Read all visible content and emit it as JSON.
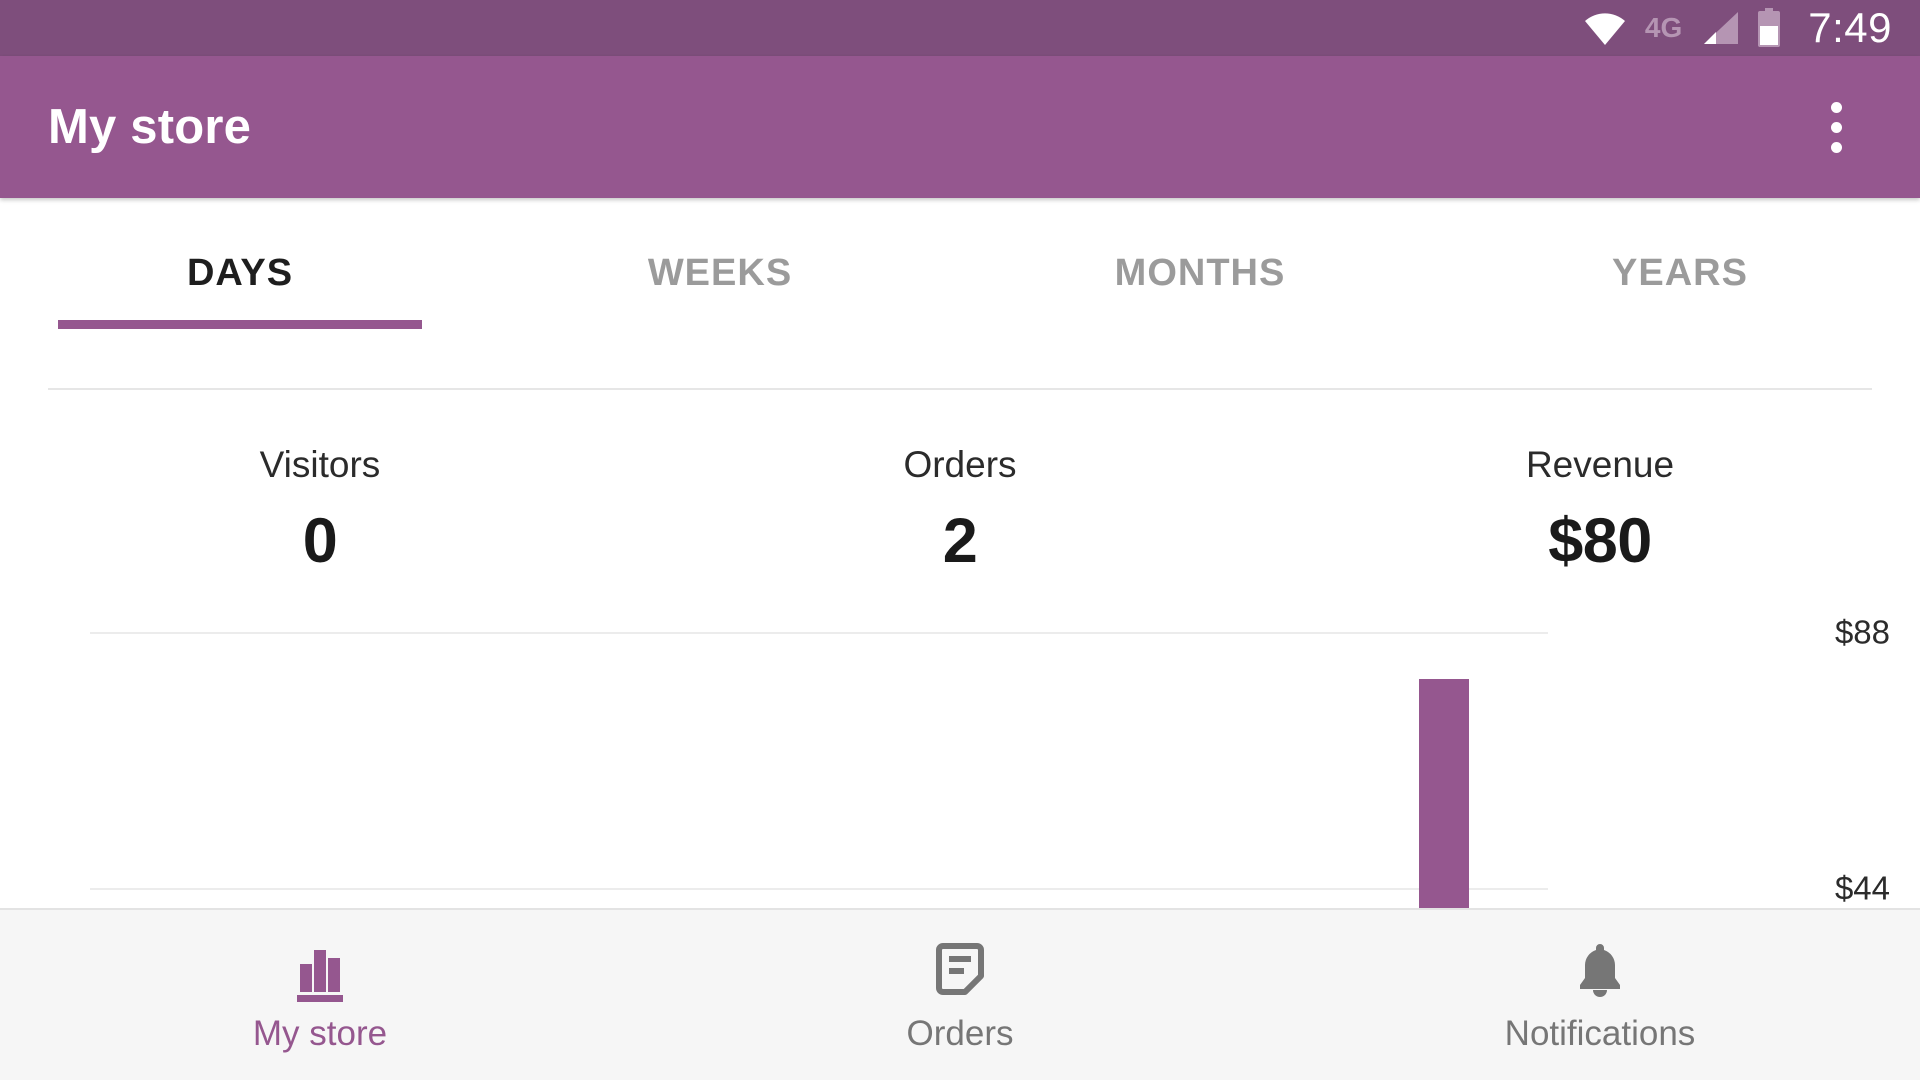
{
  "status_bar": {
    "wifi_icon": "wifi-icon",
    "network_label": "4G",
    "signal_icon": "cellular-signal-icon",
    "battery_icon": "battery-icon",
    "time": "7:49",
    "background_color": "#7e4e7c"
  },
  "app_bar": {
    "title": "My store",
    "overflow_icon": "more-vertical-icon",
    "background_color": "#95578f",
    "text_color": "#ffffff"
  },
  "tabs": {
    "active_index": 0,
    "indicator_color": "#95578f",
    "items": [
      {
        "label": "DAYS"
      },
      {
        "label": "WEEKS"
      },
      {
        "label": "MONTHS"
      },
      {
        "label": "YEARS"
      }
    ]
  },
  "stats": [
    {
      "label": "Visitors",
      "value": "0"
    },
    {
      "label": "Orders",
      "value": "2"
    },
    {
      "label": "Revenue",
      "value": "$80"
    }
  ],
  "chart_data": {
    "type": "bar",
    "title": "",
    "xlabel": "",
    "ylabel": "",
    "categories": [
      "",
      "",
      "",
      "",
      "",
      "",
      ""
    ],
    "values": [
      0,
      0,
      0,
      0,
      0,
      0,
      80
    ],
    "bar_color": "#95578f",
    "grid": true,
    "legend": "none",
    "gridlines": [
      {
        "label": "$88",
        "value": 88
      },
      {
        "label": "$44",
        "value": 44
      }
    ],
    "ylim": [
      0,
      88
    ],
    "tick_labels": [
      "$88",
      "$44"
    ],
    "annotations": "Chart is clipped by the bottom navigation bar; only one bar (revenue $80) is visible at the right edge of the plot."
  },
  "bottom_nav": {
    "active_index": 0,
    "active_color": "#95578f",
    "inactive_color": "#767676",
    "items": [
      {
        "label": "My store",
        "icon": "bar-chart-icon"
      },
      {
        "label": "Orders",
        "icon": "order-document-icon"
      },
      {
        "label": "Notifications",
        "icon": "bell-icon"
      }
    ]
  }
}
